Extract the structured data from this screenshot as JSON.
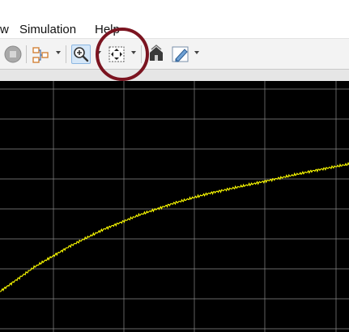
{
  "menubar": {
    "items": [
      {
        "label": "w"
      },
      {
        "label": "Simulation"
      },
      {
        "label": "Help"
      }
    ]
  },
  "toolbar": {
    "buttons": [
      {
        "icon": "stop-icon"
      },
      {
        "icon": "block-diagram-icon",
        "has_dropdown": true
      },
      {
        "icon": "zoom-in-icon",
        "has_dropdown": true,
        "pressed": true
      },
      {
        "icon": "fit-to-view-icon",
        "has_dropdown": true
      },
      {
        "icon": "restore-view-icon"
      },
      {
        "icon": "style-edit-icon",
        "has_dropdown": true
      }
    ]
  },
  "annotation": {
    "color": "#7b1420"
  },
  "plot": {
    "background": "#000000",
    "grid_color": "#8a8a8a",
    "line_color": "#ffff00"
  },
  "chart_data": {
    "type": "line",
    "grid": true,
    "series": [
      {
        "color": "#ffff00",
        "x": [
          0,
          0.1,
          0.2,
          0.3,
          0.4,
          0.5,
          0.6,
          0.7,
          0.8,
          0.9,
          1.0
        ],
        "y": [
          0.0,
          0.23,
          0.42,
          0.58,
          0.71,
          0.82,
          0.91,
          0.98,
          1.05,
          1.12,
          1.18
        ]
      }
    ]
  }
}
